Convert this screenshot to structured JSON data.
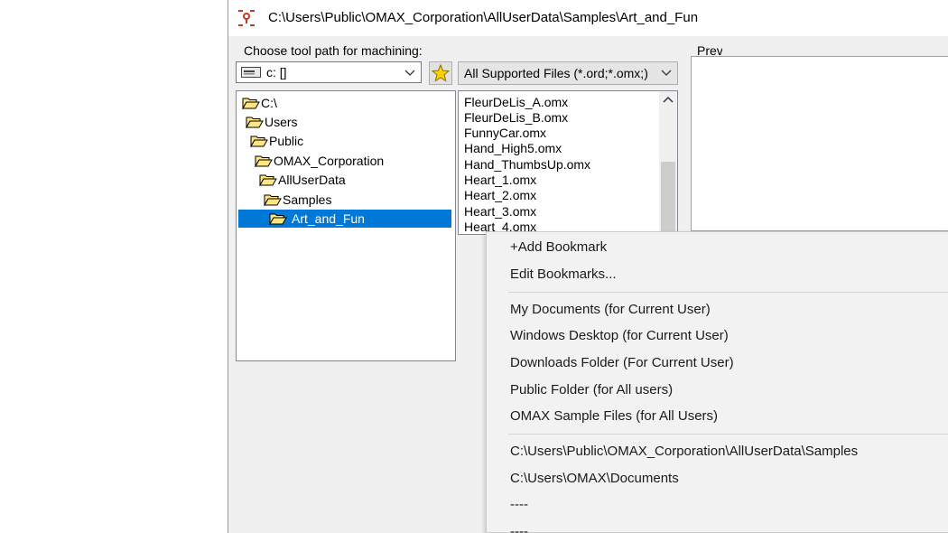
{
  "window": {
    "title": "C:\\Users\\Public\\OMAX_Corporation\\AllUserData\\Samples\\Art_and_Fun"
  },
  "chooser": {
    "group_label": "Choose tool path for machining:",
    "drive": "c: []",
    "filter": "All Supported Files (*.ord;*.omx;)",
    "preview_label": "Preview"
  },
  "tree": [
    {
      "label": "C:\\"
    },
    {
      "label": "Users"
    },
    {
      "label": "Public"
    },
    {
      "label": "OMAX_Corporation"
    },
    {
      "label": "AllUserData"
    },
    {
      "label": "Samples"
    },
    {
      "label": "Art_and_Fun",
      "selected": true
    }
  ],
  "files": [
    "FleurDeLis_A.omx",
    "FleurDeLis_B.omx",
    "FunnyCar.omx",
    "Hand_High5.omx",
    "Hand_ThumbsUp.omx",
    "Heart_1.omx",
    "Heart_2.omx",
    "Heart_3.omx",
    "Heart_4.omx"
  ],
  "menu": {
    "bookmarks": [
      "+Add Bookmark",
      "Edit Bookmarks..."
    ],
    "locations": [
      "My Documents (for Current User)",
      "Windows Desktop (for Current User)",
      "Downloads Folder (For Current User)",
      "Public Folder (for All users)",
      "OMAX Sample Files (for All Users)"
    ],
    "recent": [
      "C:\\Users\\Public\\OMAX_Corporation\\AllUserData\\Samples",
      "C:\\Users\\OMAX\\Documents",
      "----",
      "----"
    ]
  },
  "colors": {
    "selection": "#0078d7",
    "folder": "#ffe680",
    "star": "#ffd200"
  }
}
